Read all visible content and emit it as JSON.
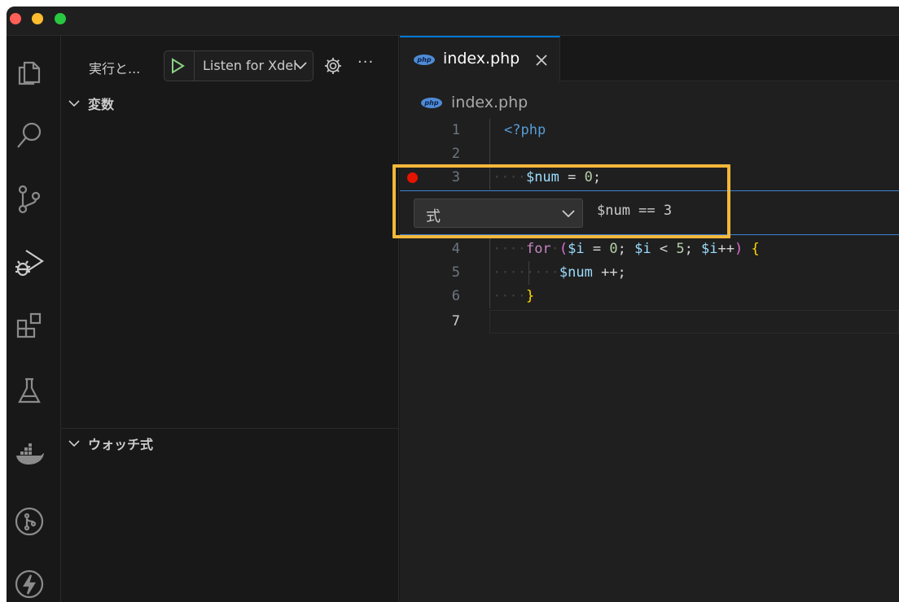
{
  "colors": {
    "accent": "#0078d4",
    "breakpoint": "#e51400",
    "highlight": "#f4b73a",
    "play": "#89d185"
  },
  "window": {
    "traffic_lights": [
      "close",
      "minimize",
      "maximize"
    ]
  },
  "activity_bar": {
    "items": [
      {
        "name": "explorer-icon"
      },
      {
        "name": "search-icon"
      },
      {
        "name": "source-control-icon"
      },
      {
        "name": "run-debug-icon"
      },
      {
        "name": "extensions-icon"
      },
      {
        "name": "testing-icon"
      },
      {
        "name": "docker-icon"
      },
      {
        "name": "git-graph-icon"
      },
      {
        "name": "thunder-client-icon"
      }
    ]
  },
  "sidebar": {
    "run_label": "実行と...",
    "config_label": "Listen for Xdebug",
    "sections": {
      "variables": "変数",
      "watch": "ウォッチ式"
    }
  },
  "editor": {
    "tab_title": "index.php",
    "php_badge": "php",
    "breadcrumb_file": "index.php",
    "lines": [
      {
        "n": "1"
      },
      {
        "n": "2"
      },
      {
        "n": "3"
      },
      {
        "n": "4"
      },
      {
        "n": "5"
      },
      {
        "n": "6"
      },
      {
        "n": "7"
      }
    ],
    "code": {
      "l1": "<?php",
      "l3_var": "$num",
      "l3_eq": " = ",
      "l3_num": "0",
      "l3_end": ";",
      "l4_for": "for",
      "l4_open": "(",
      "l4_i1": "$i",
      "l4_eq": " = ",
      "l4_zero": "0",
      "l4_semi1": "; ",
      "l4_i2": "$i",
      "l4_lt": " < ",
      "l4_five": "5",
      "l4_semi2": "; ",
      "l4_i3": "$i",
      "l4_inc": "++",
      "l4_close": ")",
      "l4_brace": " {",
      "l5_var": "$num",
      "l5_inc": " ++;",
      "l6_brace": "}"
    },
    "breakpoint_widget": {
      "type_label": "式",
      "expression": "$num == 3"
    }
  }
}
